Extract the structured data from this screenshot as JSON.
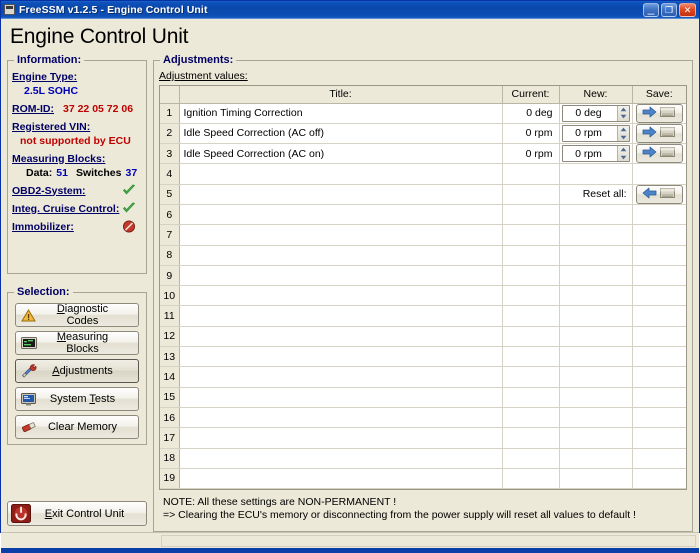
{
  "window": {
    "title": "FreeSSM v1.2.5 - Engine Control Unit",
    "icon": "app-icon",
    "minimize_label": "_",
    "maximize_label": "❐",
    "close_label": "✕"
  },
  "page_title": "Engine Control Unit",
  "information": {
    "legend": "Information:",
    "engine_type_label": "Engine Type:",
    "engine_type_value": "2.5L SOHC",
    "rom_id_label": "ROM-ID:",
    "rom_id_value": "37 22 05 72 06",
    "registered_vin_label": "Registered VIN:",
    "registered_vin_value": "not supported by ECU",
    "measuring_blocks_label": "Measuring Blocks:",
    "data_label": "Data:",
    "data_value": "51",
    "switches_label": "Switches",
    "switches_value": "37",
    "obd2_label": "OBD2-System:",
    "obd2_status": "supported",
    "cruise_label": "Integ. Cruise Control:",
    "cruise_status": "supported",
    "immobilizer_label": "Immobilizer:",
    "immobilizer_status": "not-supported"
  },
  "selection": {
    "legend": "Selection:",
    "items": [
      {
        "label": "Diagnostic Codes",
        "mnemonic": "D",
        "icon": "warning-triangle-icon",
        "active": false
      },
      {
        "label": "Measuring Blocks",
        "mnemonic": "M",
        "icon": "display-meter-icon",
        "active": false
      },
      {
        "label": "Adjustments",
        "mnemonic": "A",
        "icon": "tools-icon",
        "active": true
      },
      {
        "label": "System Tests",
        "mnemonic": "T",
        "icon": "monitor-icon",
        "active": false
      },
      {
        "label": "Clear Memory",
        "mnemonic": "",
        "icon": "eraser-icon",
        "active": false
      }
    ]
  },
  "exit_button": {
    "label": "Exit Control Unit",
    "mnemonic": "E",
    "icon": "power-icon"
  },
  "adjustments": {
    "legend": "Adjustments:",
    "sublabel": "Adjustment values:",
    "columns": [
      "",
      "Title:",
      "Current:",
      "New:",
      "Save:"
    ],
    "reset_all_label": "Reset all:",
    "rows": [
      {
        "num": "1",
        "title": "Ignition Timing Correction",
        "current": "0 deg",
        "new": "0 deg",
        "has_controls": true
      },
      {
        "num": "2",
        "title": "Idle Speed Correction (AC off)",
        "current": "0 rpm",
        "new": "0 rpm",
        "has_controls": true
      },
      {
        "num": "3",
        "title": "Idle Speed Correction (AC on)",
        "current": "0 rpm",
        "new": "0 rpm",
        "has_controls": true
      },
      {
        "num": "4",
        "title": "",
        "current": "",
        "new": "",
        "has_controls": false
      },
      {
        "num": "5",
        "title": "",
        "current": "",
        "new": "",
        "has_controls": false,
        "is_reset_row": true
      },
      {
        "num": "6",
        "title": "",
        "current": "",
        "new": "",
        "has_controls": false
      },
      {
        "num": "7",
        "title": "",
        "current": "",
        "new": "",
        "has_controls": false
      },
      {
        "num": "8",
        "title": "",
        "current": "",
        "new": "",
        "has_controls": false
      },
      {
        "num": "9",
        "title": "",
        "current": "",
        "new": "",
        "has_controls": false
      },
      {
        "num": "10",
        "title": "",
        "current": "",
        "new": "",
        "has_controls": false
      },
      {
        "num": "11",
        "title": "",
        "current": "",
        "new": "",
        "has_controls": false
      },
      {
        "num": "12",
        "title": "",
        "current": "",
        "new": "",
        "has_controls": false
      },
      {
        "num": "13",
        "title": "",
        "current": "",
        "new": "",
        "has_controls": false
      },
      {
        "num": "14",
        "title": "",
        "current": "",
        "new": "",
        "has_controls": false
      },
      {
        "num": "15",
        "title": "",
        "current": "",
        "new": "",
        "has_controls": false
      },
      {
        "num": "16",
        "title": "",
        "current": "",
        "new": "",
        "has_controls": false
      },
      {
        "num": "17",
        "title": "",
        "current": "",
        "new": "",
        "has_controls": false
      },
      {
        "num": "18",
        "title": "",
        "current": "",
        "new": "",
        "has_controls": false
      },
      {
        "num": "19",
        "title": "",
        "current": "",
        "new": "",
        "has_controls": false
      }
    ]
  },
  "note": {
    "line1": "NOTE:  All these settings are NON-PERMANENT !",
    "line2": "=> Clearing the ECU's memory or disconnecting from the power supply will reset all values to default !"
  },
  "colors": {
    "titlebar_blue": "#0a47ab",
    "client_bg": "#ece9d8",
    "legend_blue": "#000066",
    "value_red": "#c00000",
    "value_blue": "#0000bb",
    "check_green": "#35a03a",
    "deny_red": "#c0392b",
    "arrow_blue": "#3b72b8"
  }
}
